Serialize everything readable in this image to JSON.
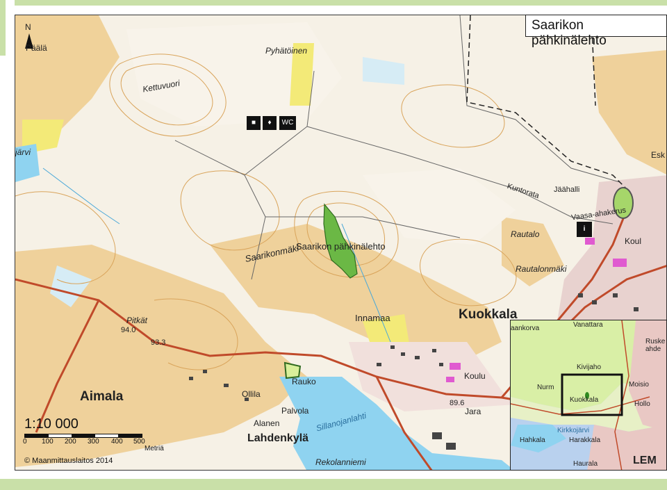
{
  "title": "Saarikon pähkinälehto",
  "map_labels": {
    "reserve": "Saarikon pähkinälehto",
    "aimala": "Aimala",
    "lahdenkyla": "Lahdenkylä",
    "kuokkala": "Kuokkala",
    "innamaa": "Innamaa",
    "pitkat": "Pitkät",
    "elev_940": "94.0",
    "elev_933": "93.3",
    "elev_896": "89.6",
    "ollila": "Ollila",
    "rauko": "Rauko",
    "palvola": "Palvola",
    "alanen": "Alanen",
    "sillanojanlahti": "Sillanojanlahti",
    "rekolanniemi": "Rekolanniemi",
    "kettuvuori": "Kettuvuori",
    "pyhatoinen": "Pyhätöinen",
    "saarikonmaki": "Saarikonmäki",
    "kuntorata": "Kuntorata",
    "jaahalli": "Jäähalli",
    "rautalo": "Rautalo",
    "rautalonmaki": "Rautalonmäki",
    "koulu": "Koulu",
    "koulu_right": "Koul",
    "jara": "Jara",
    "esk": "Esk",
    "paala": "Päälä",
    "jarvi": "järvi",
    "vaasa": "Vaasa-ahakerus"
  },
  "icons": [
    "picnic-icon",
    "fire-icon",
    "wc-icon",
    "info-icon"
  ],
  "icon_text": {
    "wc": "WC",
    "info": "i"
  },
  "north": "N",
  "scale": {
    "ratio": "1:10 000",
    "ticks": [
      "0",
      "100",
      "200",
      "300",
      "400",
      "500"
    ],
    "unit": "Metriä"
  },
  "copyright": "© Maanmittauslaitos 2014",
  "inset": {
    "labels": {
      "aankorva": "aankorva",
      "vanattara": "Vanattara",
      "ruskeahde": "Ruske ahde",
      "kivijaho": "Kivijaho",
      "nurm": "Nurm",
      "moisio": "Moisio",
      "kuokkala": "Kuokkala",
      "hollo": "Hollo",
      "hahkala": "Hahkala",
      "kirkkojarvi": "Kirkkojärvi",
      "harakkala": "Harakkala",
      "haurala": "Haurala",
      "lem": "LEM"
    }
  }
}
